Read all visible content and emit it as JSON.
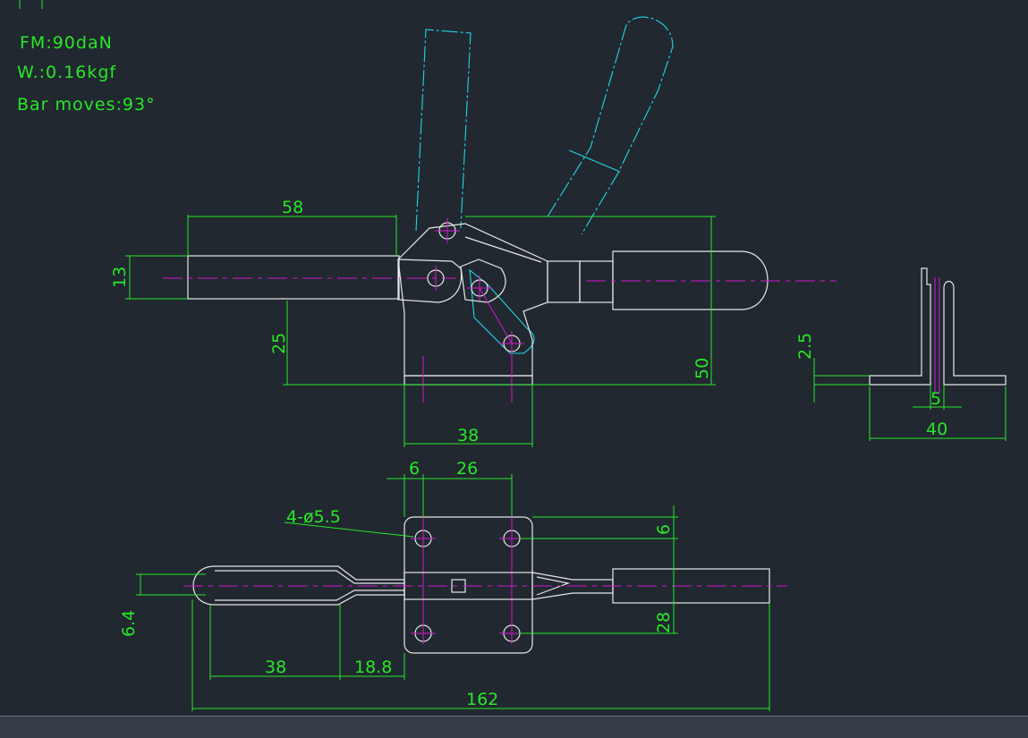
{
  "notes": {
    "force": "FM:90daN",
    "weight": "W.:0.16kgf",
    "bar_moves": "Bar moves:93°"
  },
  "dimensions": {
    "handle_length": "58",
    "bar_height": "13",
    "pivot_height": "25",
    "overall_height": "50",
    "base_length": "38",
    "flange": "2.5",
    "gap": "5",
    "base_width": "40",
    "hole_offset": "6",
    "hole_spacing": "26",
    "holes": "4-ø5.5",
    "hole_row_offset": "6",
    "hole_row_spacing": "28",
    "grip_height": "6.4",
    "grip_length": "38",
    "neck_length": "18.8",
    "overall_length": "162"
  },
  "colors": {
    "background": "#212830",
    "dimension": "#27e827",
    "outline": "#e8e8e8",
    "phantom": "#1fd7e6",
    "centerline": "#d317d3"
  }
}
